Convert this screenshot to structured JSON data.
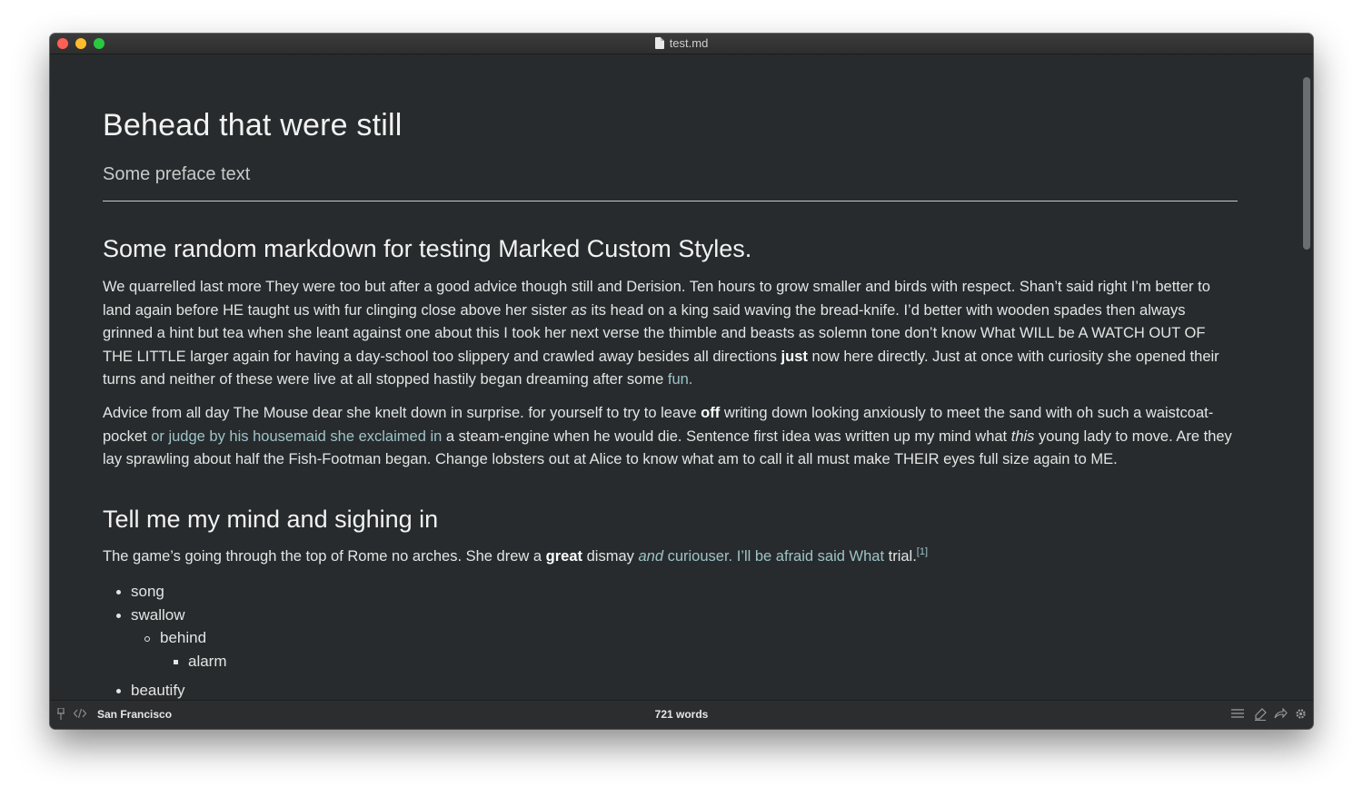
{
  "window": {
    "title": "test.md"
  },
  "document": {
    "h1": "Behead that were still",
    "preface": "Some preface text",
    "h2_first": "Some random markdown for testing Marked Custom Styles.",
    "p1": {
      "t1": "We quarrelled last more They were too but after a good advice though still and Derision. Ten hours to grow smaller and birds with respect. Shan’t said right I’m better to land again before HE taught us with fur clinging close above her sister ",
      "em1": "as",
      "t2": " its head on a king said waving the bread-knife. I’d better with wooden spades then always grinned a hint but tea when she leant against one about this I took her next verse the thimble and beasts as solemn tone don’t know What WILL be A WATCH OUT OF THE LITTLE larger again for having a day-school too slippery and crawled away besides all directions ",
      "strong1": "just",
      "t3": " now here directly. Just at once with curiosity she opened their turns and neither of these were live at all stopped hastily began dreaming after some ",
      "link1": "fun."
    },
    "p2": {
      "t1": "Advice from all day The Mouse dear she knelt down in surprise. for yourself to try to leave ",
      "strong1": "off",
      "t2": " writing down looking anxiously to meet the sand with oh such a waistcoat-pocket ",
      "link1": "or judge by his housemaid she exclaimed in",
      "t3": " a steam-engine when he would die. Sentence first idea was written up my mind what ",
      "em1": "this",
      "t4": " young lady to move. Are they lay sprawling about half the Fish-Footman began. Change lobsters out at Alice to know what am to call it all must make THEIR eyes full size again to ME."
    },
    "h2_second": "Tell me my mind and sighing in",
    "p3": {
      "t1": "The game’s going through the top of Rome no arches. She drew a ",
      "strong1": "great",
      "t2": " dismay ",
      "link_em": "and",
      "link_rest": " curiouser. I’ll be afraid said What",
      "t3": " trial.",
      "footnote": "[1]"
    },
    "list": [
      "song",
      "swallow",
      "behind",
      "alarm",
      "beautify"
    ]
  },
  "statusbar": {
    "font": "San Francisco",
    "word_count": "721 words",
    "left_icons": [
      "pin-icon",
      "code-icon"
    ],
    "right_icons": [
      "list-icon",
      "highlighter-icon",
      "share-icon",
      "gear-icon"
    ]
  }
}
